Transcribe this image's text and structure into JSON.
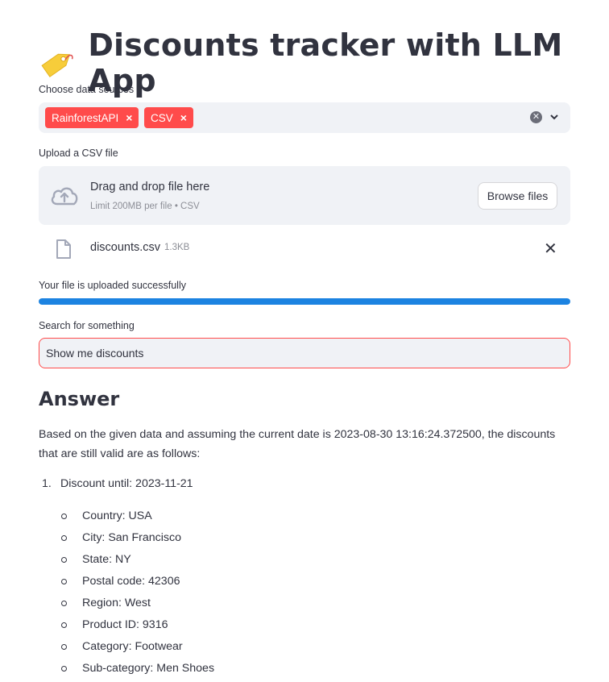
{
  "header": {
    "title": "Discounts tracker with LLM App",
    "icon": "price-tag-icon"
  },
  "data_sources": {
    "label": "Choose data sources",
    "selected": [
      "RainforestAPI",
      "CSV"
    ],
    "chip_color": "#ff4b4b"
  },
  "upload": {
    "label": "Upload a CSV file",
    "dropzone_text": "Drag and drop file here",
    "limit_text": "Limit 200MB per file • CSV",
    "browse_label": "Browse files",
    "file_name": "discounts.csv",
    "file_size": "1.3KB",
    "status_text": "Your file is uploaded successfully",
    "progress": 1.0,
    "progress_color": "#1c83e1"
  },
  "search": {
    "label": "Search for something",
    "value": "Show me discounts"
  },
  "answer": {
    "heading": "Answer",
    "intro": "Based on the given data and assuming the current date is 2023-08-30 13:16:24.372500, the discounts that are still valid are as follows:",
    "items": [
      {
        "number": "1.",
        "text": "Discount until: 2023-11-21",
        "details": [
          "Country: USA",
          "City: San Francisco",
          "State: NY",
          "Postal code: 42306",
          "Region: West",
          "Product ID: 9316",
          "Category: Footwear",
          "Sub-category: Men Shoes"
        ]
      }
    ]
  }
}
